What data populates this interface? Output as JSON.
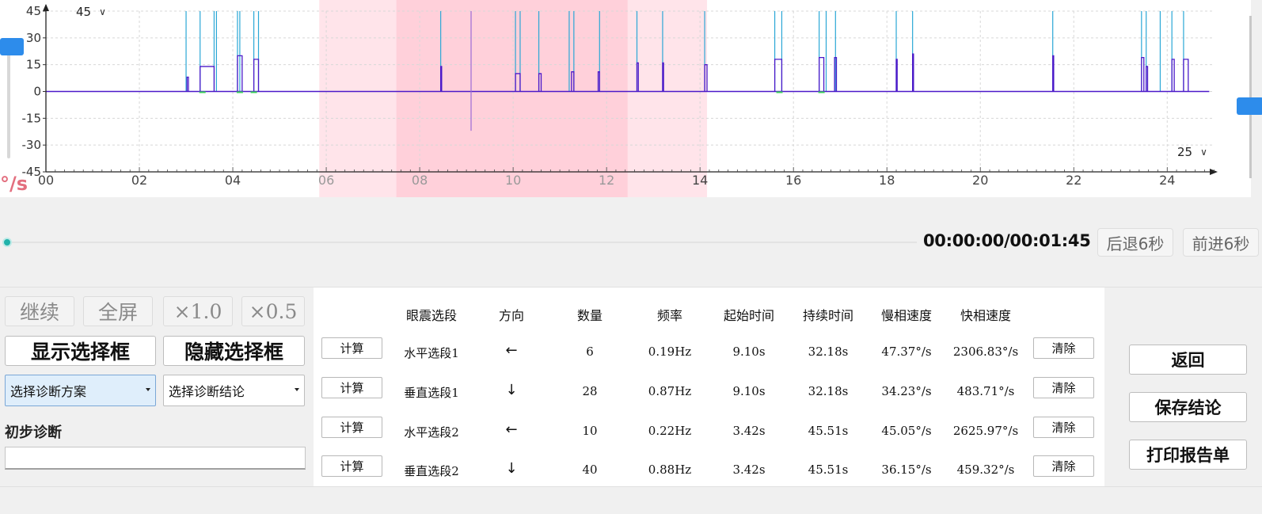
{
  "chart": {
    "unit": "°/s",
    "scale_left": "45",
    "scale_right": "25"
  },
  "chart_data": {
    "type": "line",
    "ylim": [
      -45,
      45
    ],
    "xlim": [
      0,
      25
    ],
    "y_ticks": [
      "45",
      "30",
      "15",
      "0",
      "-15",
      "-30",
      "-45"
    ],
    "y_tick_values": [
      45,
      30,
      15,
      0,
      -15,
      -30,
      -45
    ],
    "x_ticks": [
      "00",
      "02",
      "04",
      "06",
      "08",
      "10",
      "12",
      "14",
      "16",
      "18",
      "20",
      "22",
      "24"
    ],
    "x_tick_values": [
      0,
      2,
      4,
      6,
      8,
      10,
      12,
      14,
      16,
      18,
      20,
      22,
      24
    ],
    "grid": true,
    "selection_light": [
      5.85,
      14.15
    ],
    "selection_dark": [
      7.5,
      12.45
    ],
    "colors": {
      "horizontal": "#2aa7d6",
      "vertical": "#4b19c9",
      "light": "#ffe4ea",
      "dark": "#ffd0da"
    },
    "spikes_horizontal": [
      3.0,
      3.3,
      3.6,
      3.65,
      4.1,
      4.15,
      4.45,
      4.55,
      8.45,
      10.05,
      10.15,
      10.55,
      11.2,
      11.3,
      11.85,
      12.65,
      13.2,
      14.1,
      15.6,
      15.75,
      16.55,
      16.7,
      16.9,
      18.2,
      18.55,
      21.55,
      23.45,
      23.55,
      23.85,
      24.1,
      24.35
    ],
    "step_segments": [
      {
        "x0": 3.02,
        "x1": 3.05,
        "y": 8
      },
      {
        "x0": 3.3,
        "x1": 3.6,
        "y": 14
      },
      {
        "x0": 4.1,
        "x1": 4.2,
        "y": 20
      },
      {
        "x0": 4.45,
        "x1": 4.55,
        "y": 18
      },
      {
        "x0": 8.45,
        "x1": 8.47,
        "y": 14
      },
      {
        "x0": 10.05,
        "x1": 10.15,
        "y": 10
      },
      {
        "x0": 10.55,
        "x1": 10.6,
        "y": 10
      },
      {
        "x0": 11.25,
        "x1": 11.3,
        "y": 11
      },
      {
        "x0": 11.82,
        "x1": 11.85,
        "y": 11
      },
      {
        "x0": 12.65,
        "x1": 12.68,
        "y": 16
      },
      {
        "x0": 13.2,
        "x1": 13.22,
        "y": 16
      },
      {
        "x0": 14.1,
        "x1": 14.15,
        "y": 15
      },
      {
        "x0": 15.6,
        "x1": 15.75,
        "y": 18
      },
      {
        "x0": 16.55,
        "x1": 16.65,
        "y": 19
      },
      {
        "x0": 16.88,
        "x1": 16.92,
        "y": 19
      },
      {
        "x0": 18.2,
        "x1": 18.22,
        "y": 18
      },
      {
        "x0": 18.55,
        "x1": 18.57,
        "y": 21
      },
      {
        "x0": 21.55,
        "x1": 21.57,
        "y": 20
      },
      {
        "x0": 23.45,
        "x1": 23.5,
        "y": 19
      },
      {
        "x0": 23.55,
        "x1": 23.58,
        "y": 14
      },
      {
        "x0": 24.1,
        "x1": 24.15,
        "y": 18
      },
      {
        "x0": 24.35,
        "x1": 24.45,
        "y": 18
      }
    ],
    "negative_spike": {
      "x": 9.1,
      "y": -22
    }
  },
  "playback": {
    "time": "00:00:00/00:01:45",
    "back_label": "后退6秒",
    "forward_label": "前进6秒",
    "progress": 0.0
  },
  "controls": {
    "continue": "继续",
    "fullscreen": "全屏",
    "speed1": "×1.0",
    "speed05": "×0.5",
    "show_box": "显示选择框",
    "hide_box": "隐藏选择框",
    "scheme": "选择诊断方案",
    "conclusion": "选择诊断结论",
    "prelim_label": "初步诊断",
    "prelim_value": ""
  },
  "table": {
    "headers": [
      "眼震选段",
      "方向",
      "数量",
      "频率",
      "起始时间",
      "持续时间",
      "慢相速度",
      "快相速度"
    ],
    "calc_label": "计算",
    "clear_label": "清除",
    "rows": [
      {
        "segment": "水平选段1",
        "direction": "←",
        "count": "6",
        "freq": "0.19Hz",
        "start": "9.10s",
        "duration": "32.18s",
        "slow": "47.37°/s",
        "fast": "2306.83°/s"
      },
      {
        "segment": "垂直选段1",
        "direction": "↓",
        "count": "28",
        "freq": "0.87Hz",
        "start": "9.10s",
        "duration": "32.18s",
        "slow": "34.23°/s",
        "fast": "483.71°/s"
      },
      {
        "segment": "水平选段2",
        "direction": "←",
        "count": "10",
        "freq": "0.22Hz",
        "start": "3.42s",
        "duration": "45.51s",
        "slow": "45.05°/s",
        "fast": "2625.97°/s"
      },
      {
        "segment": "垂直选段2",
        "direction": "↓",
        "count": "40",
        "freq": "0.88Hz",
        "start": "3.42s",
        "duration": "45.51s",
        "slow": "36.15°/s",
        "fast": "459.32°/s"
      }
    ]
  },
  "actions": {
    "back": "返回",
    "save": "保存结论",
    "print": "打印报告单"
  }
}
